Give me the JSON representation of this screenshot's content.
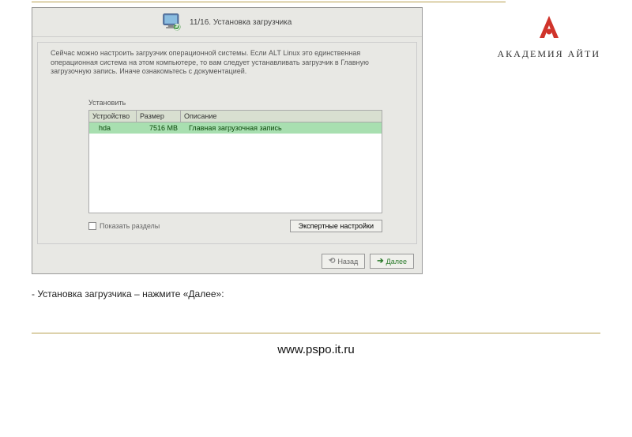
{
  "academy": {
    "label": "АКАДЕМИЯ АЙТИ"
  },
  "installer": {
    "step_title": "11/16. Установка загрузчика",
    "intro": "Сейчас можно настроить загрузчик операционной системы. Если ALT Linux это единственная операционная система на этом компьютере, то вам следует устанавливать загрузчик в Главную загрузочную запись. Иначе ознакомьтесь с документацией.",
    "section_label": "Установить",
    "columns": {
      "device": "Устройство",
      "size": "Размер",
      "desc": "Описание"
    },
    "row": {
      "device": "hda",
      "size": "7516 MB",
      "desc": "Главная загрузочная запись"
    },
    "show_partitions_label": "Показать разделы",
    "expert_button": "Экспертные настройки",
    "back_button": "Назад",
    "next_button": "Далее"
  },
  "caption": "- Установка загрузчика – нажмите «Далее»:",
  "footer_url": "www.pspo.it.ru"
}
